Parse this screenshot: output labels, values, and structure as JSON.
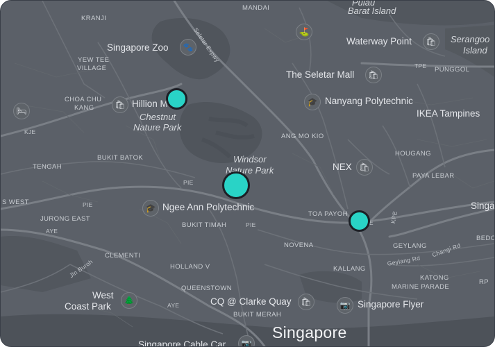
{
  "map": {
    "city": "Singapore",
    "marker_color": "#29d3c6",
    "areas": [
      {
        "id": "kranji",
        "text": "KRANJI"
      },
      {
        "id": "mandai",
        "text": "MANDAI"
      },
      {
        "id": "yew-tee",
        "text": "YEW TEE"
      },
      {
        "id": "village",
        "text": "VILLAGE"
      },
      {
        "id": "choa-chu",
        "text": "CHOA CHU"
      },
      {
        "id": "kang",
        "text": "KANG"
      },
      {
        "id": "bukit-batok",
        "text": "BUKIT BATOK"
      },
      {
        "id": "tengah",
        "text": "TENGAH"
      },
      {
        "id": "s-west",
        "text": "S WEST"
      },
      {
        "id": "jurong-east",
        "text": "JURONG EAST"
      },
      {
        "id": "bukit-timah",
        "text": "BUKIT TIMAH"
      },
      {
        "id": "clementi",
        "text": "CLEMENTI"
      },
      {
        "id": "holland-v",
        "text": "HOLLAND V"
      },
      {
        "id": "queenstown",
        "text": "QUEENSTOWN"
      },
      {
        "id": "bukit-merah",
        "text": "BUKIT MERAH"
      },
      {
        "id": "novena",
        "text": "NOVENA"
      },
      {
        "id": "toa-payoh",
        "text": "TOA PAYOH"
      },
      {
        "id": "ang-mo-kio",
        "text": "ANG MO KIO"
      },
      {
        "id": "hougang",
        "text": "HOUGANG"
      },
      {
        "id": "paya-lebar",
        "text": "PAYA LEBAR"
      },
      {
        "id": "punggol",
        "text": "PUNGGOL"
      },
      {
        "id": "geylang",
        "text": "GEYLANG"
      },
      {
        "id": "kallang",
        "text": "KALLANG"
      },
      {
        "id": "katong",
        "text": "KATONG"
      },
      {
        "id": "marine-parade",
        "text": "MARINE PARADE"
      },
      {
        "id": "bedo",
        "text": "BEDO"
      },
      {
        "id": "rp",
        "text": "RP"
      }
    ],
    "pois": [
      {
        "id": "singapore-zoo",
        "text": "Singapore Zoo"
      },
      {
        "id": "the-seletar-mall",
        "text": "The Seletar Mall"
      },
      {
        "id": "nanyang-polytechnic",
        "text": "Nanyang Polytechnic"
      },
      {
        "id": "ikea-tampines",
        "text": "IKEA Tampines"
      },
      {
        "id": "waterway-point",
        "text": "Waterway Point"
      },
      {
        "id": "ngee-ann-polytechnic",
        "text": "Ngee Ann Polytechnic"
      },
      {
        "id": "nex",
        "text": "NEX"
      },
      {
        "id": "cq-clarke-quay",
        "text": "CQ @ Clarke Quay"
      },
      {
        "id": "singapore-flyer",
        "text": "Singapore Flyer"
      },
      {
        "id": "west-coast-park-1",
        "text": "West"
      },
      {
        "id": "west-coast-park-2",
        "text": "Coast Park"
      },
      {
        "id": "hillion",
        "text": "Hillion M"
      },
      {
        "id": "singapore-cable-car",
        "text": "Singapore Cable Car"
      },
      {
        "id": "singa",
        "text": "Singa"
      }
    ],
    "parks": [
      {
        "id": "chestnut-1",
        "text": "Chestnut"
      },
      {
        "id": "chestnut-2",
        "text": "Nature Park"
      },
      {
        "id": "windsor-1",
        "text": "Windsor"
      },
      {
        "id": "windsor-2",
        "text": "Nature Park"
      },
      {
        "id": "pulau-1",
        "text": "Pulau"
      },
      {
        "id": "pulau-2",
        "text": "Barat Island"
      },
      {
        "id": "serangoon-1",
        "text": "Serangoo"
      },
      {
        "id": "serangoon-2",
        "text": "Island"
      }
    ],
    "roads": [
      {
        "id": "sle",
        "text": "Seletar Expwy"
      },
      {
        "id": "pie-1",
        "text": "PIE"
      },
      {
        "id": "pie-2",
        "text": "PIE"
      },
      {
        "id": "pie-3",
        "text": "PIE"
      },
      {
        "id": "aye-1",
        "text": "AYE"
      },
      {
        "id": "aye-2",
        "text": "AYE"
      },
      {
        "id": "kje",
        "text": "KJE"
      },
      {
        "id": "tpe",
        "text": "TPE"
      },
      {
        "id": "cte",
        "text": "CTE"
      },
      {
        "id": "kpe",
        "text": "KPE"
      },
      {
        "id": "jln-buroh",
        "text": "Jln Buroh"
      },
      {
        "id": "geylang-rd",
        "text": "Geylang Rd"
      },
      {
        "id": "changi-rd",
        "text": "Changi Rd"
      }
    ],
    "poi_icons": [
      {
        "id": "zoo-icon",
        "glyph": "🐾"
      },
      {
        "id": "hillion-icon",
        "glyph": "🛍"
      },
      {
        "id": "hotel-icon",
        "glyph": "🛏"
      },
      {
        "id": "golf-icon",
        "glyph": "⛳"
      },
      {
        "id": "waterway-icon",
        "glyph": "🛍"
      },
      {
        "id": "seletar-icon",
        "glyph": "🛍"
      },
      {
        "id": "nanyang-icon",
        "glyph": "🎓"
      },
      {
        "id": "ngee-ann-icon",
        "glyph": "🎓"
      },
      {
        "id": "nex-icon",
        "glyph": "🛍"
      },
      {
        "id": "toa-payoh-icon",
        "glyph": "🛍"
      },
      {
        "id": "clarke-quay-icon",
        "glyph": "🛍"
      },
      {
        "id": "flyer-icon",
        "glyph": "📷"
      },
      {
        "id": "west-coast-icon",
        "glyph": "🌲"
      },
      {
        "id": "cable-car-icon",
        "glyph": "📷"
      }
    ],
    "markers": [
      {
        "id": "marker-hillion",
        "size": "small"
      },
      {
        "id": "marker-windsor",
        "size": "large"
      },
      {
        "id": "marker-toa-payoh",
        "size": "small"
      }
    ]
  }
}
